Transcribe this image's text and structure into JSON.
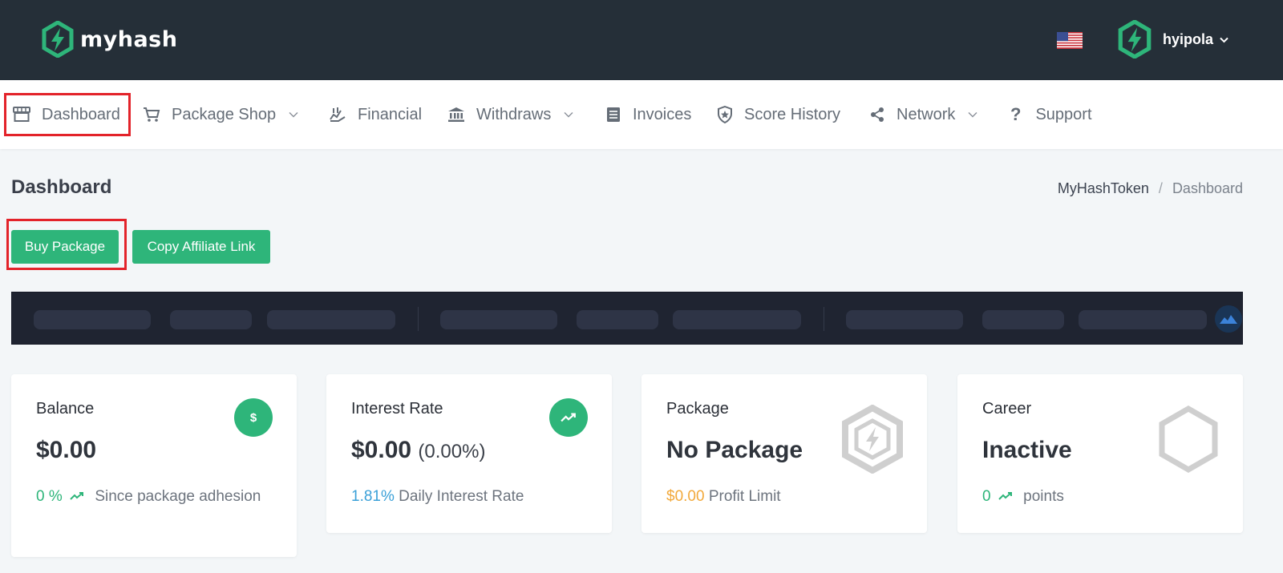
{
  "brand": {
    "name": "myhash"
  },
  "user": {
    "name": "hyipola"
  },
  "nav": {
    "items": [
      {
        "label": "Dashboard",
        "icon": "store-icon",
        "active": true
      },
      {
        "label": "Package Shop",
        "icon": "cart-icon",
        "dropdown": true
      },
      {
        "label": "Financial",
        "icon": "chart-hand-icon"
      },
      {
        "label": "Withdraws",
        "icon": "bank-icon",
        "dropdown": true
      },
      {
        "label": "Invoices",
        "icon": "document-icon"
      },
      {
        "label": "Score History",
        "icon": "shield-star-icon"
      },
      {
        "label": "Network",
        "icon": "share-icon",
        "dropdown": true
      },
      {
        "label": "Support",
        "icon": "question-icon"
      }
    ]
  },
  "page": {
    "title": "Dashboard",
    "breadcrumb": [
      "MyHashToken",
      "/",
      "Dashboard"
    ]
  },
  "actions": {
    "buy_label": "Buy Package",
    "copy_label": "Copy Affiliate Link"
  },
  "cards": {
    "balance": {
      "title": "Balance",
      "value": "$0.00",
      "stat": "0 %",
      "foot": "Since package adhesion",
      "icon": "dollar-icon"
    },
    "interest": {
      "title": "Interest Rate",
      "value": "$0.00",
      "value_sub": "(0.00%)",
      "stat": "1.81%",
      "foot": "Daily Interest Rate",
      "icon": "trending-up-icon"
    },
    "package": {
      "title": "Package",
      "value": "No Package",
      "stat": "$0.00",
      "foot": "Profit Limit",
      "icon": "hexagon-bolt-icon"
    },
    "career": {
      "title": "Career",
      "value": "Inactive",
      "stat": "0",
      "foot": "points",
      "icon": "hexagon-icon"
    }
  },
  "colors": {
    "accent": "#2eb57a",
    "topbar": "#252f38",
    "highlight": "#e3232a",
    "info": "#3aa0d8",
    "warning": "#f2a93b"
  }
}
